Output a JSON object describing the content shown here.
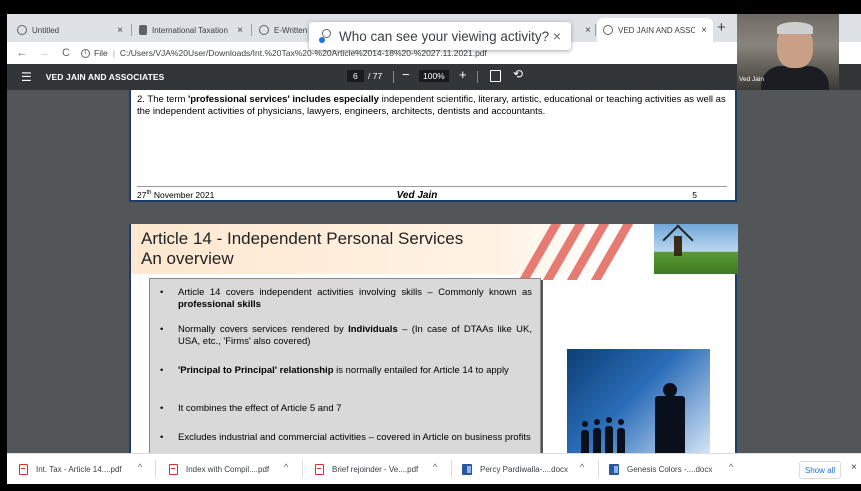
{
  "tabs": [
    {
      "title": "Untitled",
      "close": "×",
      "icon": "globe-icon"
    },
    {
      "title": "International Taxation",
      "close": "×",
      "icon": "doc-icon"
    },
    {
      "title": "E-Written Su",
      "close": "×",
      "icon": "globe-icon"
    },
    {
      "title": "",
      "close": "×",
      "icon": ""
    },
    {
      "title": "VED JAIN AND ASSOC",
      "close": "×",
      "icon": "globe-icon"
    }
  ],
  "new_tab": "+",
  "nav": {
    "back": "←",
    "forward": "→",
    "reload": "C"
  },
  "address": {
    "info": "i",
    "scheme": "File",
    "separator": "|",
    "url": "C:/Users/VJA%20User/Downloads/Int.%20Tax%20-%20Article%2014-18%20-%2027.11.2021.pdf"
  },
  "popup": {
    "text": "Who can see your viewing activity?",
    "close": "×"
  },
  "pdf_toolbar": {
    "menu": "☰",
    "title": "VED JAIN AND ASSOCIATES",
    "page_current": "6",
    "page_total": "/ 77",
    "zoom_out": "−",
    "zoom": "100%",
    "zoom_in": "+",
    "rotate": "⟲"
  },
  "page1": {
    "text_lead": "2. The term ",
    "text_bold": "'professional services' includes especially",
    "text_rest": " independent scientific, literary, artistic, educational or teaching activities as well as the independent activities of physicians, lawyers, engineers, architects, dentists and accountants.",
    "footer_date": "27",
    "footer_date_sup": "th",
    "footer_date_rest": " November 2021",
    "footer_author": "Ved Jain",
    "footer_page": "5"
  },
  "page2": {
    "title_line1": "Article 14 - Independent Personal Services",
    "title_line2": "An overview",
    "bullets": [
      {
        "marker": "•",
        "pre": "Article 14 covers independent activities involving skills – Commonly known as ",
        "bold": "professional skills",
        "post": ""
      },
      {
        "marker": "•",
        "pre": "Normally covers services rendered by ",
        "bold": "Individuals",
        "post": " – (In case of DTAAs like UK, USA, etc., 'Firms' also covered)"
      },
      {
        "marker": "•",
        "pre": "",
        "bold": "'Principal to Principal' relationship",
        "post": " is normally entailed for Article 14 to apply"
      },
      {
        "marker": "•",
        "pre": "It combines the effect of Article 5 and 7",
        "bold": "",
        "post": ""
      },
      {
        "marker": "•",
        "pre": "Excludes industrial and commercial activities – covered in Article on business profits",
        "bold": "",
        "post": ""
      }
    ]
  },
  "webcam": {
    "name": "Ved Jain"
  },
  "downloads": [
    {
      "name": "Int. Tax - Article 14....pdf",
      "type": "pdf"
    },
    {
      "name": "Index with Compil....pdf",
      "type": "pdf"
    },
    {
      "name": "Brief rejoinder - Ve....pdf",
      "type": "pdf"
    },
    {
      "name": "Percy Pardiwalla-....docx",
      "type": "docx"
    },
    {
      "name": "Genesis Colors -....docx",
      "type": "docx"
    }
  ],
  "download_chevron": "^",
  "show_all": "Show all",
  "downloads_close": "×"
}
